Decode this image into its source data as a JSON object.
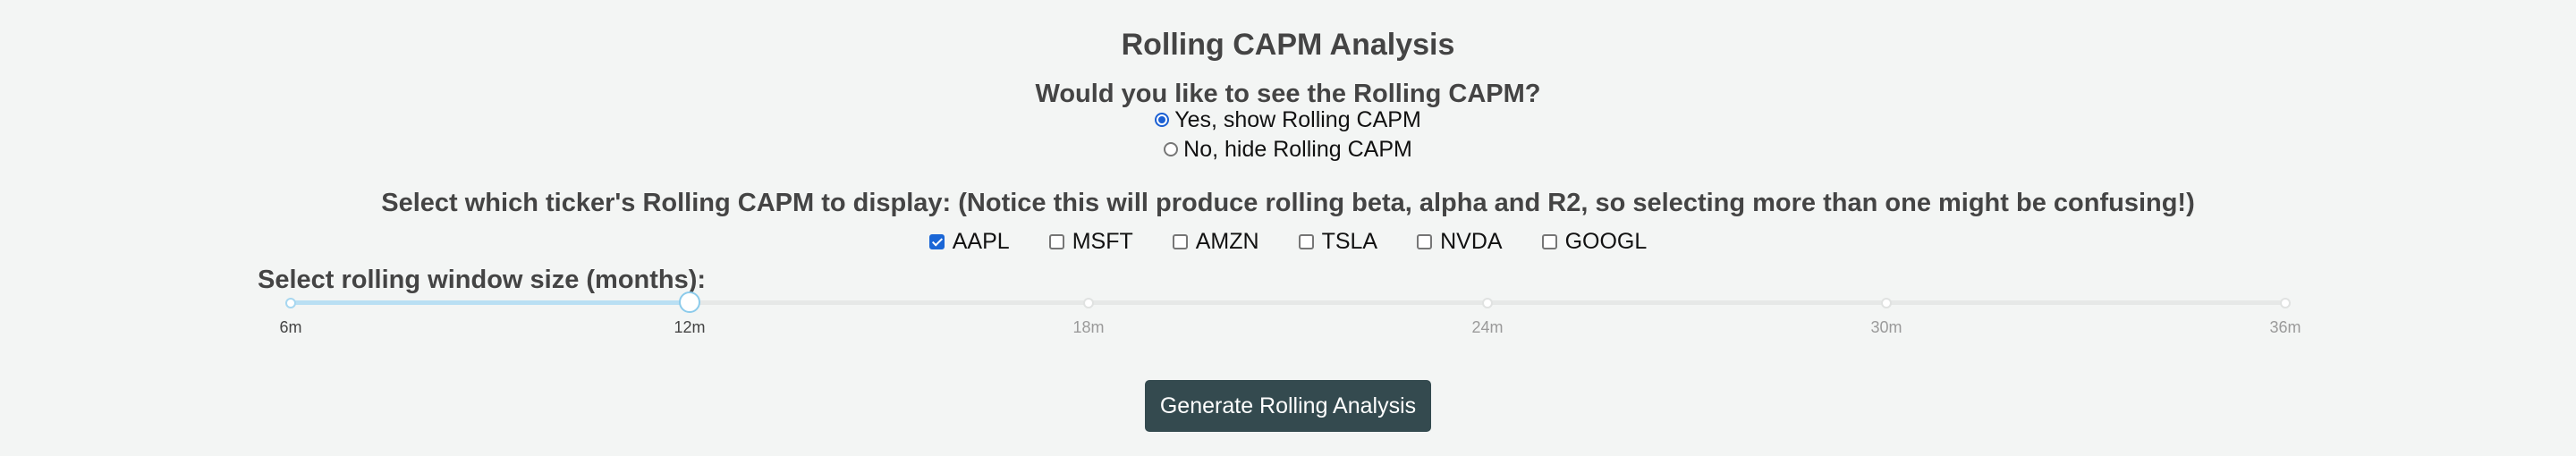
{
  "title": "Rolling CAPM Analysis",
  "show_question": {
    "label": "Would you like to see the Rolling CAPM?",
    "options": [
      {
        "label": "Yes, show Rolling CAPM",
        "selected": true
      },
      {
        "label": "No, hide Rolling CAPM",
        "selected": false
      }
    ]
  },
  "ticker_select": {
    "label": "Select which ticker's Rolling CAPM to display: (Notice this will produce rolling beta, alpha and R2, so selecting more than one might be confusing!)",
    "tickers": [
      {
        "label": "AAPL",
        "checked": true
      },
      {
        "label": "MSFT",
        "checked": false
      },
      {
        "label": "AMZN",
        "checked": false
      },
      {
        "label": "TSLA",
        "checked": false
      },
      {
        "label": "NVDA",
        "checked": false
      },
      {
        "label": "GOOGL",
        "checked": false
      }
    ]
  },
  "window_slider": {
    "label": "Select rolling window size (months):",
    "marks": [
      "6m",
      "12m",
      "18m",
      "24m",
      "30m",
      "36m"
    ],
    "min": 6,
    "max": 36,
    "value": 12
  },
  "generate_button": {
    "label": "Generate Rolling Analysis"
  },
  "colors": {
    "accent": "#1a66d6",
    "slider_fill": "#b9dff3",
    "button_bg": "#344a4f",
    "background": "#f3f5f4"
  }
}
